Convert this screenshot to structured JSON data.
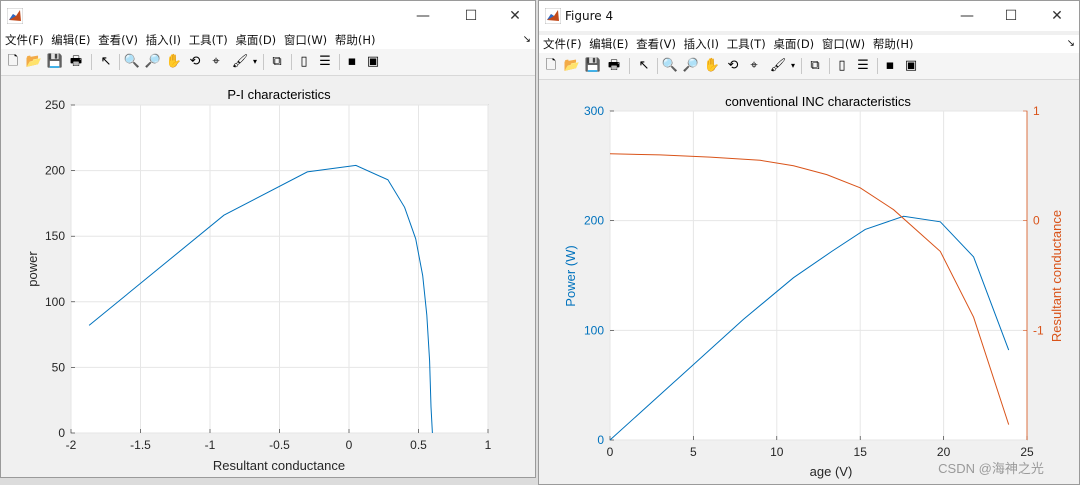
{
  "windows": [
    {
      "title": "",
      "menu": [
        "文件(F)",
        "编辑(E)",
        "查看(V)",
        "插入(I)",
        "工具(T)",
        "桌面(D)",
        "窗口(W)",
        "帮助(H)"
      ],
      "controls": [
        "—",
        "☐",
        "✕"
      ]
    },
    {
      "title": "Figure 4",
      "menu": [
        "文件(F)",
        "编辑(E)",
        "查看(V)",
        "插入(I)",
        "工具(T)",
        "桌面(D)",
        "窗口(W)",
        "帮助(H)"
      ],
      "controls": [
        "—",
        "☐",
        "✕"
      ]
    }
  ],
  "watermark": "CSDN @海神之光",
  "chart_data": [
    {
      "type": "line",
      "title": "P-I characteristics",
      "xlabel": "Resultant conductance",
      "ylabel": "power",
      "xlim": [
        -2,
        1
      ],
      "ylim": [
        0,
        250
      ],
      "xticks": [
        "-2",
        "-1.5",
        "-1",
        "-0.5",
        "0",
        "0.5",
        "1"
      ],
      "yticks": [
        "0",
        "50",
        "100",
        "150",
        "200",
        "250"
      ],
      "grid": true,
      "series": [
        {
          "color": "#0072BD",
          "x": [
            -1.87,
            -0.9,
            -0.3,
            0.05,
            0.28,
            0.4,
            0.48,
            0.53,
            0.56,
            0.58,
            0.59,
            0.6
          ],
          "y": [
            82,
            166,
            199,
            204,
            193,
            172,
            148,
            120,
            90,
            55,
            20,
            0
          ]
        }
      ]
    },
    {
      "type": "line",
      "title": "conventional INC characteristics",
      "xlabel": "age (V)",
      "ylabel": "Power (W)",
      "y2label": "Resultant conductance",
      "xlim": [
        0,
        25
      ],
      "ylim": [
        0,
        300
      ],
      "y2lim": [
        2,
        1
      ],
      "xticks": [
        "0",
        "5",
        "10",
        "15",
        "20",
        "25"
      ],
      "yticks": [
        "0",
        "100",
        "200",
        "300"
      ],
      "y2ticks": [
        "1",
        "0",
        "-1"
      ],
      "grid": true,
      "series": [
        {
          "color": "#0072BD",
          "axis": "left",
          "x": [
            0,
            4,
            8,
            11,
            13.3,
            15.3,
            17.6,
            19.8,
            21.8,
            23.9
          ],
          "y": [
            0,
            55,
            110,
            148,
            172,
            192,
            204,
            199,
            167,
            82
          ]
        },
        {
          "color": "#D95319",
          "axis": "right",
          "x": [
            0,
            3,
            6,
            9,
            11,
            13,
            15,
            17,
            19.8,
            21.8,
            23.9
          ],
          "y": [
            0.61,
            0.6,
            0.58,
            0.55,
            0.5,
            0.42,
            0.3,
            0.1,
            -0.28,
            -0.88,
            -1.86
          ]
        }
      ]
    }
  ]
}
